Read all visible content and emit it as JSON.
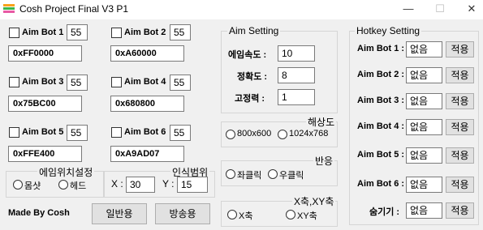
{
  "window": {
    "title": "Cosh Project Final V3 P1",
    "minimize": "—",
    "maximize": "☐",
    "close": "✕"
  },
  "bots": [
    {
      "label": "Aim Bot 1",
      "value": "55",
      "color": "0xFF0000"
    },
    {
      "label": "Aim Bot 2",
      "value": "55",
      "color": "0xA60000"
    },
    {
      "label": "Aim Bot 3",
      "value": "55",
      "color": "0x75BC00"
    },
    {
      "label": "Aim Bot 4",
      "value": "55",
      "color": "0x680800"
    },
    {
      "label": "Aim Bot 5",
      "value": "55",
      "color": "0xFFE400"
    },
    {
      "label": "Aim Bot 6",
      "value": "55",
      "color": "0xA9AD07"
    }
  ],
  "aim_position": {
    "title": "에임위치설정",
    "options": [
      "몸샷",
      "헤드"
    ]
  },
  "recognition_range": {
    "title": "인식범위",
    "x_label": "X :",
    "x_value": "30",
    "y_label": "Y :",
    "y_value": "15"
  },
  "footer": {
    "made_by": "Made By Cosh",
    "normal_button": "일반용",
    "broadcast_button": "방송용"
  },
  "aim_setting": {
    "title": "Aim Setting",
    "rows": [
      {
        "label": "에임속도 :",
        "value": "10"
      },
      {
        "label": "정확도 :",
        "value": "8"
      },
      {
        "label": "고정력 :",
        "value": "1"
      }
    ]
  },
  "resolution": {
    "title": "해상도",
    "options": [
      "800x600",
      "1024x768"
    ]
  },
  "reaction": {
    "title": "반응",
    "options": [
      "좌클릭",
      "우클릭"
    ]
  },
  "axis": {
    "title": "X축,XY축",
    "options": [
      "X축",
      "XY축"
    ]
  },
  "hotkey": {
    "title": "Hotkey Setting",
    "apply_label": "적용",
    "rows": [
      {
        "label": "Aim Bot 1 :",
        "value": "없음"
      },
      {
        "label": "Aim Bot 2 :",
        "value": "없음"
      },
      {
        "label": "Aim Bot 3 :",
        "value": "없음"
      },
      {
        "label": "Aim Bot 4 :",
        "value": "없음"
      },
      {
        "label": "Aim Bot 5 :",
        "value": "없음"
      },
      {
        "label": "Aim Bot 6 :",
        "value": "없음"
      },
      {
        "label": "숨기기 :",
        "value": "없음"
      }
    ]
  }
}
